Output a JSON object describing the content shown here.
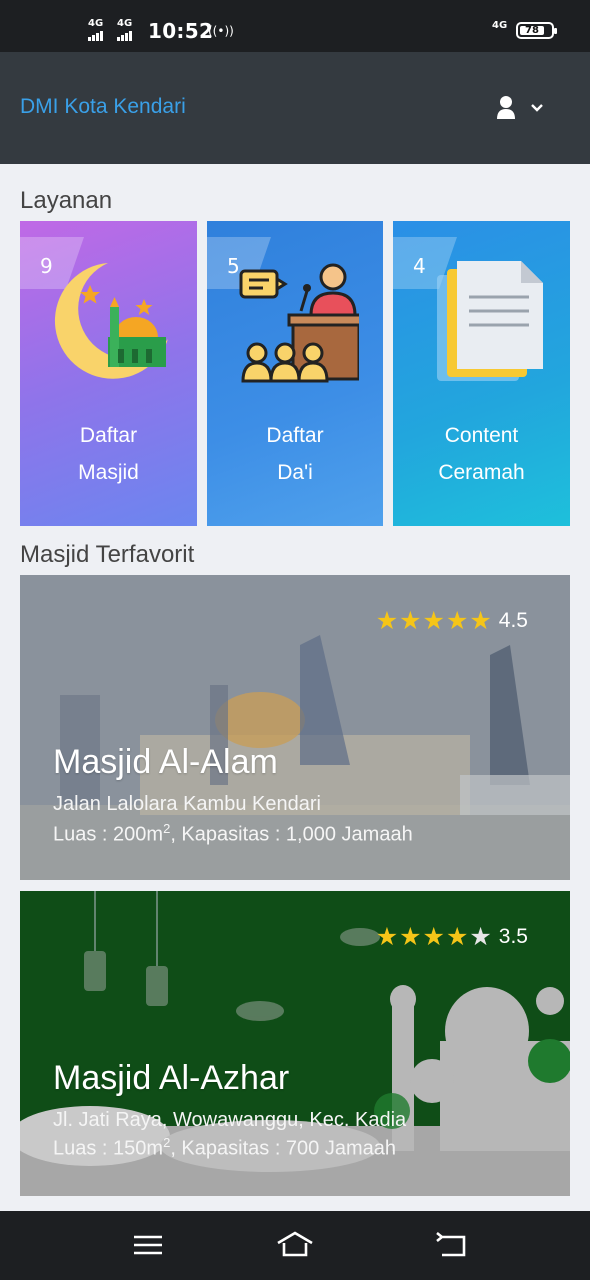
{
  "status_bar": {
    "net1": "4G",
    "net2": "4G",
    "time": "10:52",
    "net_right": "4G",
    "battery": "78"
  },
  "header": {
    "brand": "DMI Kota Kendari"
  },
  "services": {
    "title": "Layanan",
    "items": [
      {
        "count": "9",
        "line1": "Daftar",
        "line2": "Masjid",
        "icon": "mosque-crescent-icon"
      },
      {
        "count": "5",
        "line1": "Daftar",
        "line2": "Da'i",
        "icon": "preacher-podium-icon"
      },
      {
        "count": "4",
        "line1": "Content",
        "line2": "Ceramah",
        "icon": "document-icon"
      }
    ]
  },
  "favorites": {
    "title": "Masjid Terfavorit",
    "items": [
      {
        "name": "Masjid Al-Alam",
        "address": "Jalan Lalolara Kambu Kendari",
        "area": "Luas : 200m",
        "capacity": ", Kapasitas : 1,000 Jamaah",
        "rating": "4.5",
        "stars": 4.5
      },
      {
        "name": "Masjid Al-Azhar",
        "address": "Jl. Jati Raya, Wowawanggu, Kec. Kadia",
        "area": "Luas : 150m",
        "capacity": ", Kapasitas : 700 Jamaah",
        "rating": "3.5",
        "stars": 3.5
      }
    ],
    "area_sup": "2"
  },
  "colors": {
    "brand": "#3aa0e8",
    "header_bg": "#343a40",
    "star": "#f5c518"
  }
}
